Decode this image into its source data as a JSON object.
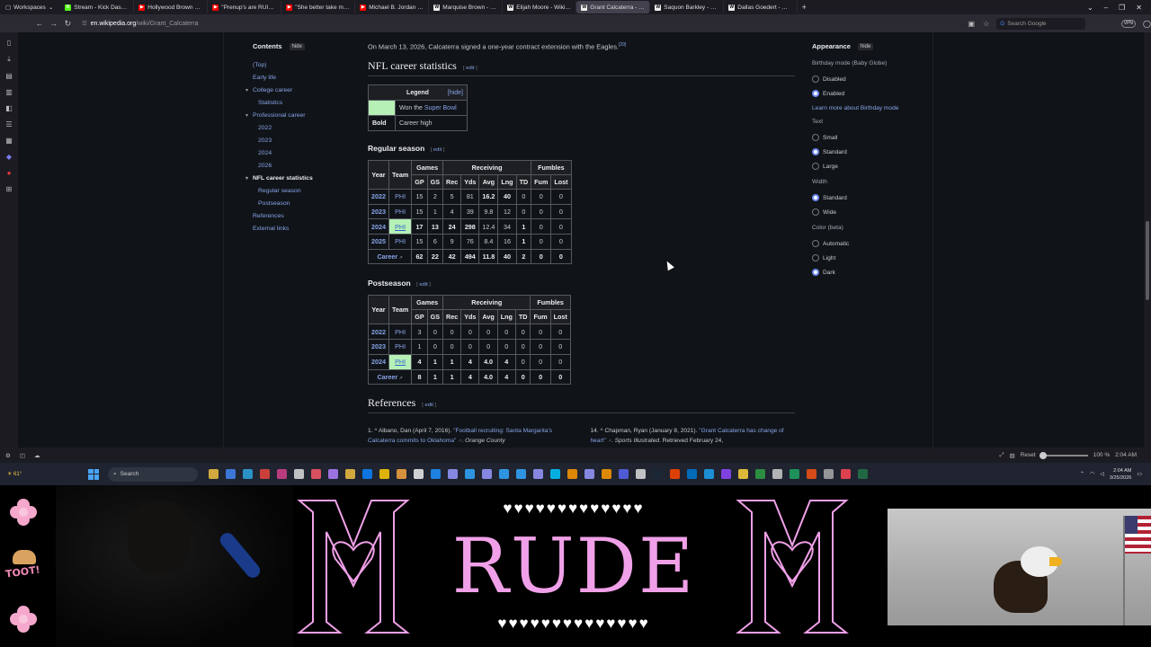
{
  "browser": {
    "workspace_label": "Workspaces",
    "tabs": [
      {
        "title": "Stream - Kick Dashboard",
        "color": "#53fc18",
        "glyph": "K"
      },
      {
        "title": "Hollywood Brown EXCLUSIVE",
        "color": "#ff0000",
        "glyph": "▶"
      },
      {
        "title": "\"Prenup's are RUINING M...",
        "color": "#ff0000",
        "glyph": "▶"
      },
      {
        "title": "\"She better take my last n...",
        "color": "#ff0000",
        "glyph": "▶"
      },
      {
        "title": "Michael B. Jordan is the n...",
        "color": "#ff0000",
        "glyph": "▶"
      },
      {
        "title": "Marquise Brown - Wikipedi...",
        "color": "#eeeeee",
        "glyph": "W"
      },
      {
        "title": "Elijah Moore - Wikipedia",
        "color": "#eeeeee",
        "glyph": "W"
      },
      {
        "title": "Grant Calcaterra - Wikiped...",
        "color": "#eeeeee",
        "glyph": "W",
        "active": true
      },
      {
        "title": "Saquon Barkley - Wikipedi...",
        "color": "#eeeeee",
        "glyph": "W"
      },
      {
        "title": "Dallas Goedert - Wikipedi...",
        "color": "#eeeeee",
        "glyph": "W"
      }
    ],
    "url_host": "en.wikipedia.org",
    "url_path": "/wiki/Grant_Calcaterra",
    "search_placeholder": "Search Google"
  },
  "toc": {
    "title": "Contents",
    "hide_label": "hide",
    "items": [
      {
        "label": "(Top)",
        "level": 1
      },
      {
        "label": "Early life",
        "level": 1
      },
      {
        "label": "College career",
        "level": 1,
        "caret": true
      },
      {
        "label": "Statistics",
        "level": 2
      },
      {
        "label": "Professional career",
        "level": 1,
        "caret": true
      },
      {
        "label": "2022",
        "level": 2
      },
      {
        "label": "2023",
        "level": 2
      },
      {
        "label": "2024",
        "level": 2
      },
      {
        "label": "2026",
        "level": 2
      },
      {
        "label": "NFL career statistics",
        "level": 1,
        "caret": true,
        "active": true
      },
      {
        "label": "Regular season",
        "level": 2
      },
      {
        "label": "Postseason",
        "level": 2
      },
      {
        "label": "References",
        "level": 1
      },
      {
        "label": "External links",
        "level": 1
      }
    ]
  },
  "article": {
    "intro": "On March 13, 2026, Calcaterra signed a one-year contract extension with the Eagles.",
    "intro_ref": "[29]",
    "nfl_heading": "NFL career statistics",
    "edit_label": "edit",
    "legend": {
      "title": "Legend",
      "hide": "hide",
      "row1_text": "Won the ",
      "row1_link": "Super Bowl",
      "row2_key": "Bold",
      "row2_text": "Career high"
    },
    "regular_heading": "Regular season",
    "post_heading": "Postseason",
    "table_headers": {
      "year": "Year",
      "team": "Team",
      "games": "Games",
      "receiving": "Receiving",
      "fumbles": "Fumbles",
      "cols": [
        "GP",
        "GS",
        "Rec",
        "Yds",
        "Avg",
        "Lng",
        "TD",
        "Fum",
        "Lost"
      ]
    },
    "regular_rows": [
      {
        "year": "2022",
        "team": "PHI",
        "vals": [
          "15",
          "2",
          "5",
          "81",
          "16.2",
          "40",
          "0",
          "0",
          "0"
        ]
      },
      {
        "year": "2023",
        "team": "PHI",
        "vals": [
          "15",
          "1",
          "4",
          "39",
          "9.8",
          "12",
          "0",
          "0",
          "0"
        ]
      },
      {
        "year": "2024",
        "team": "PHI",
        "vals": [
          "17",
          "13",
          "24",
          "298",
          "12.4",
          "34",
          "1",
          "0",
          "0"
        ],
        "sb": true
      },
      {
        "year": "2025",
        "team": "PHI",
        "vals": [
          "15",
          "6",
          "9",
          "76",
          "8.4",
          "16",
          "1",
          "0",
          "0"
        ]
      }
    ],
    "regular_career": {
      "label": "Career",
      "vals": [
        "62",
        "22",
        "42",
        "494",
        "11.8",
        "40",
        "2",
        "0",
        "0"
      ]
    },
    "post_rows": [
      {
        "year": "2022",
        "team": "PHI",
        "vals": [
          "3",
          "0",
          "0",
          "0",
          "0",
          "0",
          "0",
          "0",
          "0"
        ]
      },
      {
        "year": "2023",
        "team": "PHI",
        "vals": [
          "1",
          "0",
          "0",
          "0",
          "0",
          "0",
          "0",
          "0",
          "0"
        ]
      },
      {
        "year": "2024",
        "team": "PHI",
        "vals": [
          "4",
          "1",
          "1",
          "4",
          "4.0",
          "4",
          "0",
          "0",
          "0"
        ],
        "sb": true
      }
    ],
    "post_career": {
      "label": "Career",
      "vals": [
        "8",
        "1",
        "1",
        "4",
        "4.0",
        "4",
        "0",
        "0",
        "0"
      ]
    },
    "references_heading": "References",
    "ref1_num": "1. ^",
    "ref1_author": "Albano, Dan (April 7, 2016).",
    "ref1_link": "\"Football recruiting: Santa Margarita's Calcaterra commits to Oklahoma\"",
    "ref1_pub": "Orange County",
    "ref14_num": "14. ^",
    "ref14_author": "Chapman, Ryan (January 8, 2021).",
    "ref14_link": "\"Grant Calcaterra has change of heart\"",
    "ref14_pub": "Sports Illustrated",
    "ref14_tail": ". Retrieved February 24,"
  },
  "appearance": {
    "title": "Appearance",
    "hide_label": "hide",
    "birthday_label": "Birthday mode (Baby Globe)",
    "birthday_options": [
      {
        "label": "Disabled",
        "on": false
      },
      {
        "label": "Enabled",
        "on": true
      }
    ],
    "birthday_more": "Learn more about Birthday mode",
    "text_label": "Text",
    "text_options": [
      {
        "label": "Small",
        "on": false
      },
      {
        "label": "Standard",
        "on": true
      },
      {
        "label": "Large",
        "on": false
      }
    ],
    "width_label": "Width",
    "width_options": [
      {
        "label": "Standard",
        "on": true
      },
      {
        "label": "Wide",
        "on": false
      }
    ],
    "color_label": "Color (beta)",
    "color_options": [
      {
        "label": "Automatic",
        "on": false
      },
      {
        "label": "Light",
        "on": false
      },
      {
        "label": "Dark",
        "on": true
      }
    ]
  },
  "statusbar": {
    "reset_label": "Reset",
    "zoom": "100 %",
    "time": "2:04 AM"
  },
  "taskbar": {
    "search_label": "Search",
    "weather": "61°",
    "clock_time": "2:04 AM",
    "clock_date": "3/25/2026",
    "app_colors": [
      "#f0c040",
      "#4285f4",
      "#2ea6e0",
      "#e8453c",
      "#d53f8c",
      "#ddd",
      "#fa586a",
      "#b480ff",
      "#f0c040",
      "#0a84ff",
      "#ffcc00",
      "#f7a440",
      "#eee",
      "#1e90ff",
      "#9999ff",
      "#31a8ff",
      "#9999ff",
      "#31a8ff",
      "#31a8ff",
      "#9999ff",
      "#00c8ff",
      "#ff9a00",
      "#9999ff",
      "#ff9a00",
      "#5865f2",
      "#ddd",
      "#1b2838",
      "#ff4500",
      "#0078d4",
      "#1da1f2",
      "#9146ff",
      "#ffd43b",
      "#2ea043",
      "#ccc",
      "#1fa463",
      "#f65314",
      "#aaa",
      "#ff4655",
      "#217346"
    ]
  },
  "overlay": {
    "brand_text": "RUDE",
    "hearts_top": "♥♥♥♥♥♥♥♥♥♥♥♥♥",
    "hearts_bottom": "♥♥♥♥♥♥♥♥♥♥♥♥♥♥",
    "toot_label": "TOOT!",
    "accent": "#f0a0e8"
  }
}
